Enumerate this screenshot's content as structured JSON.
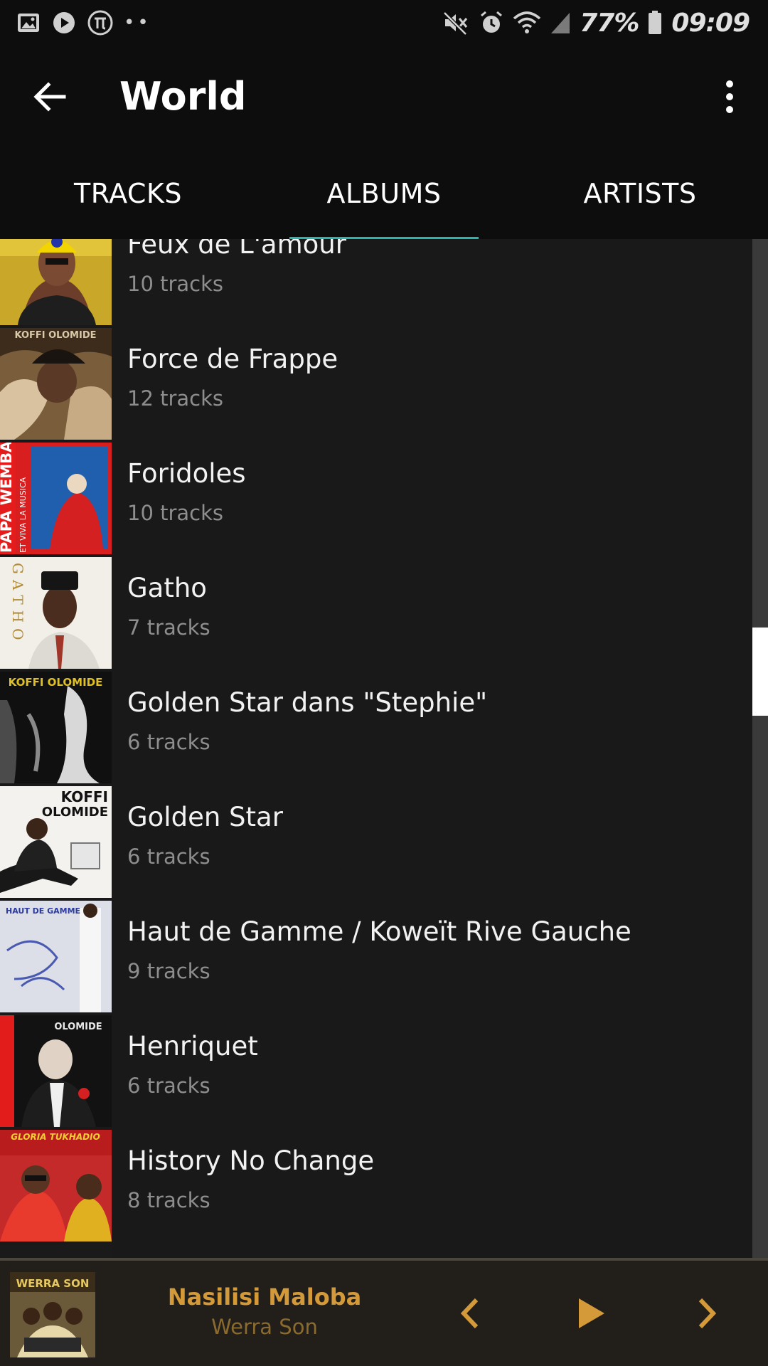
{
  "status_bar": {
    "battery": "77%",
    "time": "09:09",
    "left_icons": [
      "gallery-icon",
      "play-store-icon",
      "pi-icon",
      "more-notifications-icon"
    ],
    "right_icons": [
      "mute-icon",
      "alarm-icon",
      "wifi-icon",
      "signal-icon",
      "battery-icon"
    ]
  },
  "app_bar": {
    "title": "World",
    "back_icon": "arrow-left-icon",
    "menu_icon": "more-vertical-icon"
  },
  "tabs": [
    {
      "label": "TRACKS",
      "selected": false
    },
    {
      "label": "ALBUMS",
      "selected": true
    },
    {
      "label": "ARTISTS",
      "selected": false
    }
  ],
  "albums": [
    {
      "title": "Feux de L'amour",
      "count": "10 tracks"
    },
    {
      "title": "Force de Frappe",
      "count": "12 tracks"
    },
    {
      "title": "Foridoles",
      "count": "10 tracks"
    },
    {
      "title": "Gatho",
      "count": "7 tracks"
    },
    {
      "title": "Golden Star dans \"Stephie\"",
      "count": "6 tracks"
    },
    {
      "title": "Golden Star",
      "count": "6 tracks"
    },
    {
      "title": "Haut de Gamme / Koweït Rive Gauche",
      "count": "9 tracks"
    },
    {
      "title": "Henriquet",
      "count": "6 tracks"
    },
    {
      "title": "History No Change",
      "count": "8 tracks"
    }
  ],
  "cover_texts": {
    "force_de_frappe": "KOFFI OLOMIDE",
    "foridoles_side": "PAPA WEMBA",
    "foridoles_sub": "ET VIVA LA MUSICA",
    "gatho_side": "GATHO",
    "golden_star_dans_top": "KOFFI OLOMIDE",
    "golden_star_top1": "KOFFI",
    "golden_star_top2": "OLOMIDE",
    "haut_de_gamme_top": "HAUT DE GAMME",
    "henriquet_top": "OLOMIDE",
    "history_top": "GLORIA TUKHADIO",
    "now_playing_logo": "WERRA SON"
  },
  "now_playing": {
    "title": "Nasilisi Maloba",
    "artist": "Werra Son",
    "controls": [
      "chevron-left-icon",
      "play-icon",
      "chevron-right-icon"
    ]
  },
  "colors": {
    "accent_teal": "#2bb5ad",
    "now_playing_title": "#d49a3a",
    "now_playing_artist": "#8a6a2e",
    "list_background": "#191919",
    "header_background": "#0d0d0d"
  },
  "scroll": {
    "position_fraction": 0.53
  }
}
